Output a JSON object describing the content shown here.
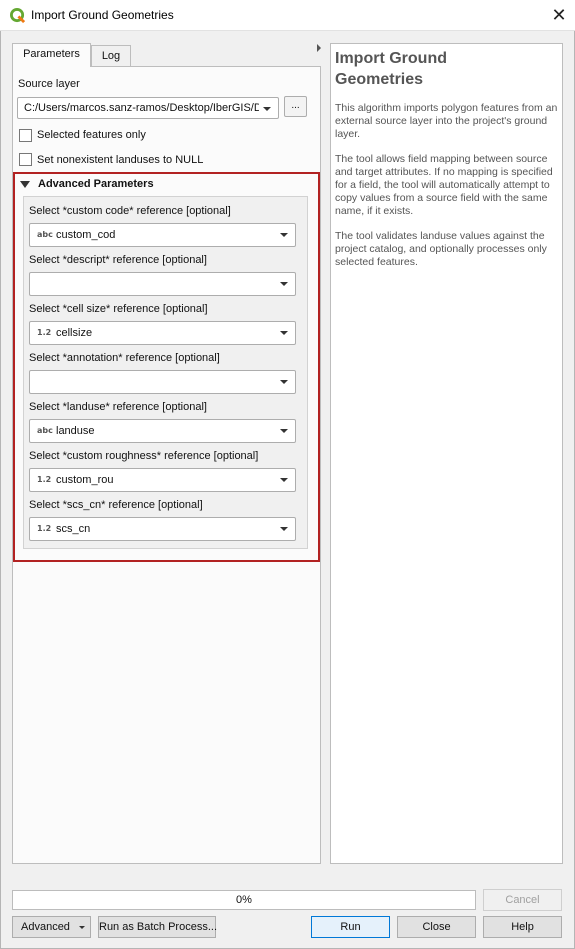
{
  "window": {
    "title": "Import Ground Geometries",
    "close_glyph": "✕",
    "icon": "qgis-icon"
  },
  "tabs": [
    {
      "label": "Parameters"
    },
    {
      "label": "Log"
    }
  ],
  "parameters": {
    "source_layer_label": "Source layer",
    "source_layer_value": "C:/Users/marcos.sanz-ramos/Desktop/IberGIS/D",
    "browse_label": "...",
    "selected_only_label": "Selected features only",
    "set_null_label": "Set nonexistent landuses to NULL",
    "advanced_header": "Advanced Parameters",
    "fields": [
      {
        "label": "Select *custom code* reference [optional]",
        "type": "abc",
        "value": "custom_cod"
      },
      {
        "label": "Select *descript* reference [optional]",
        "type": "",
        "value": ""
      },
      {
        "label": "Select *cell size* reference [optional]",
        "type": "1.2",
        "value": "cellsize"
      },
      {
        "label": "Select *annotation* reference [optional]",
        "type": "",
        "value": ""
      },
      {
        "label": "Select *landuse* reference [optional]",
        "type": "abc",
        "value": "landuse"
      },
      {
        "label": "Select *custom roughness* reference [optional]",
        "type": "1.2",
        "value": "custom_rou"
      },
      {
        "label": "Select *scs_cn* reference [optional]",
        "type": "1.2",
        "value": "scs_cn"
      }
    ]
  },
  "help": {
    "title": "Import Ground Geometries",
    "paragraphs": [
      "This algorithm imports polygon features from an external source layer into the project's ground layer.",
      "The tool allows field mapping between source and target attributes. If no mapping is specified for a field, the tool will automatically attempt to copy values from a source field with the same name, if it exists.",
      "The tool validates landuse values against the project catalog, and optionally processes only selected features."
    ]
  },
  "footer": {
    "progress_text": "0%",
    "progress_value": 0,
    "cancel": "Cancel",
    "advanced": "Advanced",
    "batch": "Run as Batch Process...",
    "run": "Run",
    "close": "Close",
    "help": "Help"
  },
  "colors": {
    "highlight": "#b22222",
    "accent": "#0078d7",
    "qgis_green": "#64a832"
  }
}
